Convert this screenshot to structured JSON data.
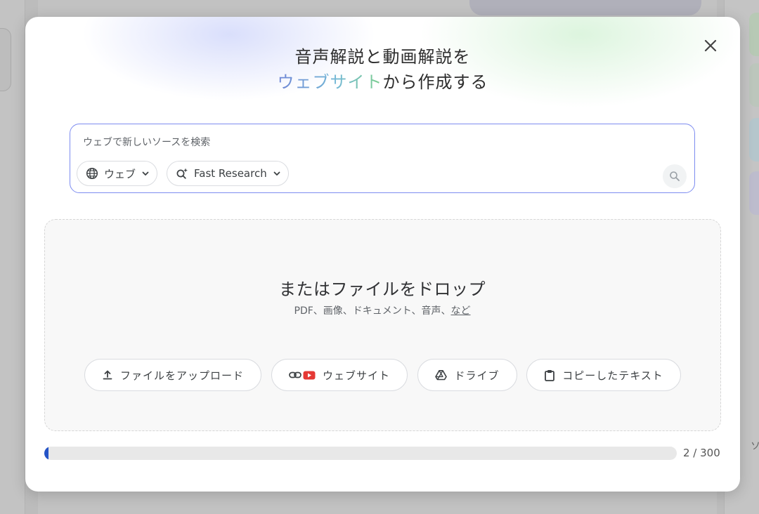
{
  "modal": {
    "title_line1": "音声解説と動画解説を",
    "title_accent": "ウェブサイト",
    "title_line2_rest": "から作成する"
  },
  "search": {
    "placeholder": "ウェブで新しいソースを検索",
    "source_chip_label": "ウェブ",
    "mode_chip_label": "Fast Research"
  },
  "dropzone": {
    "title": "またはファイルをドロップ",
    "subtitle_text": "PDF、画像、ドキュメント、音声、",
    "subtitle_link": "など"
  },
  "upload_buttons": [
    {
      "label": "ファイルをアップロード",
      "icon": "upload-icon"
    },
    {
      "label": "ウェブサイト",
      "icon": "link-youtube-icon"
    },
    {
      "label": "ドライブ",
      "icon": "drive-icon"
    },
    {
      "label": "コピーしたテキスト",
      "icon": "clipboard-icon"
    }
  ],
  "progress": {
    "current": 2,
    "max": 300,
    "label": "2 / 300",
    "color": "#2554c7"
  },
  "background": {
    "right_edge_text": "ソ"
  },
  "colors": {
    "search_border": "#7d8cf0",
    "title_gradient": [
      "#6f86d6",
      "#74b8d6",
      "#7ccf8c"
    ],
    "youtube_red": "#e53935"
  }
}
